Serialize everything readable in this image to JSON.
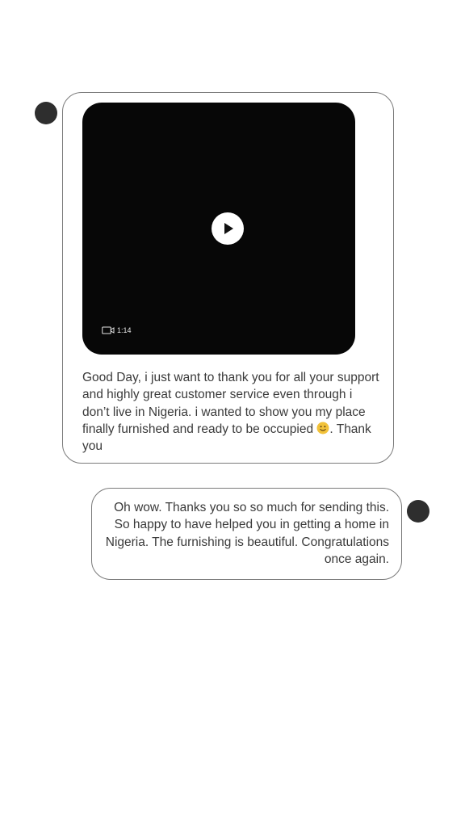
{
  "messages": [
    {
      "direction": "incoming",
      "video": {
        "duration": "1:14",
        "play_icon": "play-icon",
        "camera_icon": "video-camera-icon"
      },
      "text_before_emoji": "Good Day, i just want to thank you for all your support and highly great customer service even through i don’t live in Nigeria. i wanted to show you my place finally furnished and ready to be occupied ",
      "emoji": "slightly-smiling-face",
      "text_after_emoji": ". Thank you"
    },
    {
      "direction": "outgoing",
      "text": "Oh wow. Thanks you so so much for sending this. So happy to have helped you in getting a home in Nigeria. The furnishing is beautiful. Congratulations once again."
    }
  ],
  "colors": {
    "background": "#ffffff",
    "bubble_border": "#7a7a7a",
    "avatar": "#2e2e2e",
    "video_background": "#070707",
    "text": "#3a3a3a",
    "emoji": "#f2c23a"
  }
}
